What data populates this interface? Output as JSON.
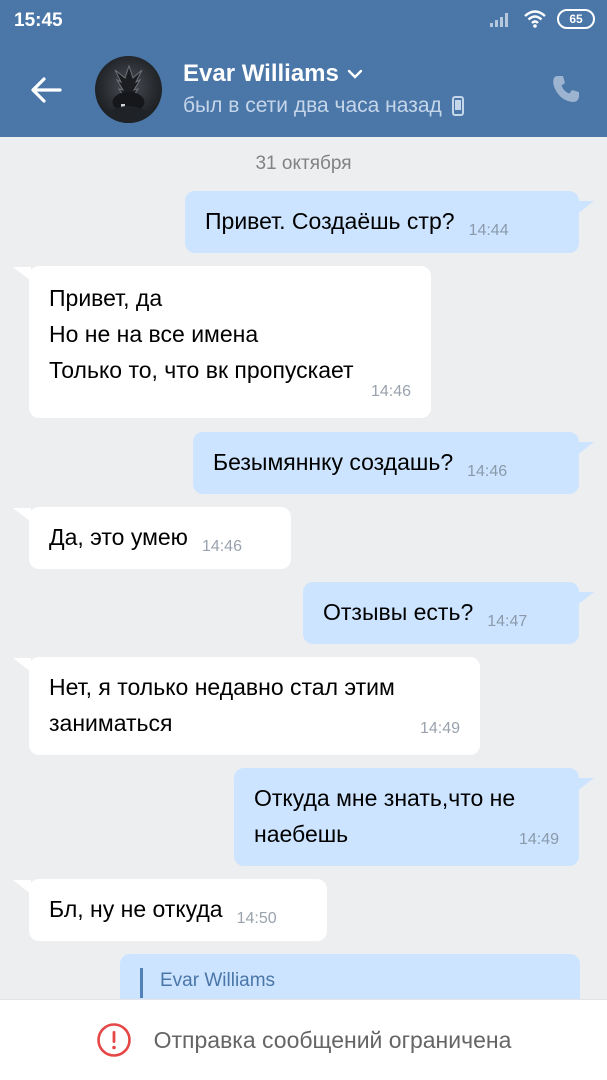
{
  "status_bar": {
    "time": "15:45",
    "battery": "65",
    "icons": [
      "signal-icon",
      "wifi-icon",
      "battery-icon"
    ]
  },
  "header": {
    "contact_name": "Evar Williams",
    "contact_status": "был в сети два часа назад",
    "icons": [
      "back-arrow-icon",
      "chevron-down-icon",
      "mobile-phone-icon",
      "phone-call-icon"
    ],
    "accent_color": "#4a76a8"
  },
  "chat": {
    "date_separator": "31 октября",
    "messages": [
      {
        "direction": "out",
        "lines": [
          "Привет. Создаёшь стр?"
        ],
        "time": "14:44"
      },
      {
        "direction": "in",
        "lines": [
          "Привет, да",
          "Но не на все имена",
          "Только то, что вк пропускает"
        ],
        "time": "14:46"
      },
      {
        "direction": "out",
        "lines": [
          "Безымяннку создашь?"
        ],
        "time": "14:46"
      },
      {
        "direction": "in",
        "lines": [
          "Да, это умею"
        ],
        "time": "14:46"
      },
      {
        "direction": "out",
        "lines": [
          "Отзывы есть?"
        ],
        "time": "14:47"
      },
      {
        "direction": "in",
        "lines": [
          "Нет, я только недавно стал этим",
          "заниматься"
        ],
        "time": "14:49"
      },
      {
        "direction": "out",
        "lines": [
          "Откуда мне знать,что не",
          "наебешь"
        ],
        "time": "14:49"
      },
      {
        "direction": "in",
        "lines": [
          "Бл, ну не откуда"
        ],
        "time": "14:50"
      }
    ],
    "reply_preview": {
      "name": "Evar Williams"
    },
    "colors": {
      "incoming": "#ffffff",
      "outgoing": "#cce4ff",
      "background": "#edeef0"
    }
  },
  "footer": {
    "text": "Отправка сообщений ограничена",
    "icon": "warning-icon",
    "icon_color": "#e64646"
  }
}
